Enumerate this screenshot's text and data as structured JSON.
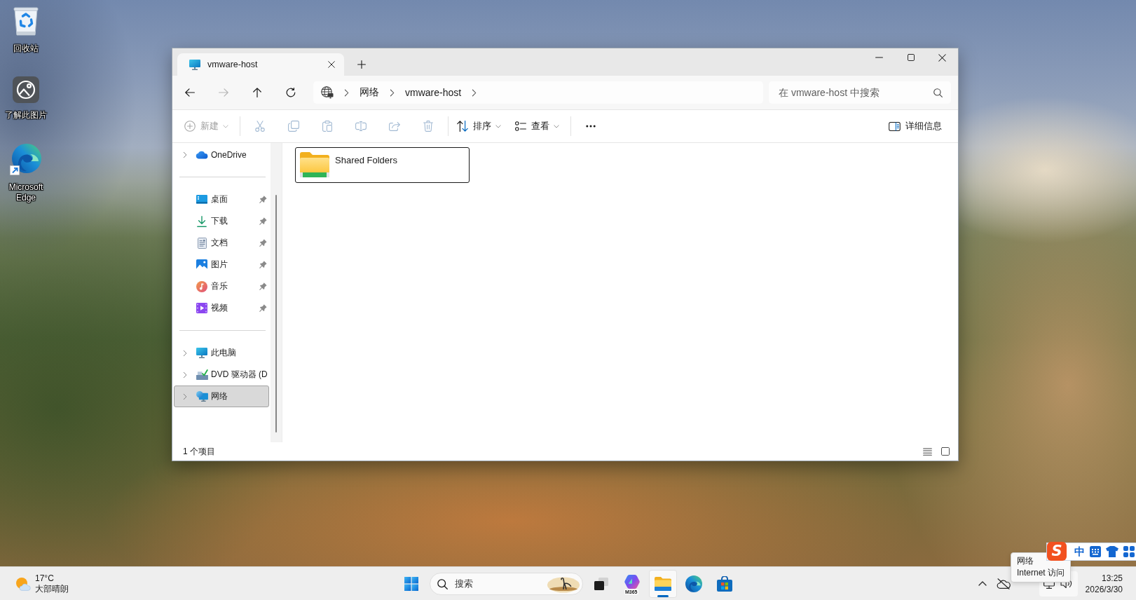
{
  "desktop": {
    "icons": [
      {
        "kind": "recycle-bin",
        "label": "回收站",
        "shortcut": false
      },
      {
        "kind": "picture-info",
        "label": "了解此图片",
        "shortcut": false
      },
      {
        "kind": "browser",
        "label": "Microsoft Edge",
        "shortcut": true
      }
    ]
  },
  "window": {
    "tabs": [
      {
        "title": "vmware-host",
        "selected": true
      }
    ],
    "navigation": [
      {
        "kind": "back",
        "disabled": false
      },
      {
        "kind": "forward",
        "disabled": true
      },
      {
        "kind": "up",
        "disabled": false
      },
      {
        "kind": "refresh",
        "disabled": false
      }
    ],
    "address": {
      "path": [
        "网络",
        "vmware-host"
      ]
    },
    "search": {
      "placeholder": "在 vmware-host 中搜索"
    },
    "toolbar": [
      {
        "kind": "new",
        "label": "新建",
        "disabled": true,
        "dropdown": true
      },
      {
        "kind": "separator"
      },
      {
        "kind": "cut",
        "disabled": true
      },
      {
        "kind": "copy",
        "disabled": true
      },
      {
        "kind": "paste",
        "disabled": true
      },
      {
        "kind": "rename",
        "disabled": true
      },
      {
        "kind": "share",
        "disabled": true
      },
      {
        "kind": "delete",
        "disabled": true
      },
      {
        "kind": "separator"
      },
      {
        "kind": "sort",
        "label": "排序",
        "disabled": false,
        "dropdown": true
      },
      {
        "kind": "view",
        "label": "查看",
        "disabled": false,
        "dropdown": true
      },
      {
        "kind": "separator"
      },
      {
        "kind": "more",
        "disabled": false
      }
    ],
    "details_button": {
      "label": "详细信息"
    },
    "sidebar": {
      "sections": [
        {
          "items": [
            {
              "kind": "onedrive",
              "label": "OneDrive",
              "expandable": true,
              "pinned": false,
              "selected": false
            }
          ]
        },
        {
          "items": [
            {
              "kind": "desktop",
              "label": "桌面",
              "expandable": false,
              "pinned": true,
              "selected": false
            },
            {
              "kind": "downloads",
              "label": "下载",
              "expandable": false,
              "pinned": true,
              "selected": false
            },
            {
              "kind": "documents",
              "label": "文档",
              "expandable": false,
              "pinned": true,
              "selected": false
            },
            {
              "kind": "pictures",
              "label": "图片",
              "expandable": false,
              "pinned": true,
              "selected": false
            },
            {
              "kind": "music",
              "label": "音乐",
              "expandable": false,
              "pinned": true,
              "selected": false
            },
            {
              "kind": "videos",
              "label": "视频",
              "expandable": false,
              "pinned": true,
              "selected": false
            }
          ]
        },
        {
          "items": [
            {
              "kind": "this-pc",
              "label": "此电脑",
              "expandable": true,
              "pinned": false,
              "selected": false
            },
            {
              "kind": "dvd",
              "label": "DVD 驱动器 (D",
              "expandable": true,
              "pinned": false,
              "selected": false
            },
            {
              "kind": "network",
              "label": "网络",
              "expandable": true,
              "pinned": false,
              "selected": true
            }
          ]
        }
      ]
    },
    "items": [
      {
        "kind": "shared-folder",
        "name": "Shared Folders",
        "focused": true
      }
    ],
    "status_bar": {
      "count": "1 个项目",
      "views": [
        {
          "kind": "details"
        },
        {
          "kind": "tiles"
        }
      ]
    }
  },
  "taskbar": {
    "weather": {
      "kind": "partly-sunny",
      "temperature": "17°C",
      "condition": "大部晴朗"
    },
    "search": {
      "placeholder": "搜索"
    },
    "apps": [
      {
        "kind": "task-view",
        "active": false
      },
      {
        "kind": "m365",
        "label": "M365",
        "active": false
      },
      {
        "kind": "file-explorer",
        "active": true
      },
      {
        "kind": "browser",
        "active": false
      },
      {
        "kind": "store",
        "active": false
      }
    ],
    "tray": {
      "icons": [
        {
          "kind": "chevron-up"
        },
        {
          "kind": "cloud-off"
        }
      ],
      "quick_settings": [
        {
          "kind": "network"
        },
        {
          "kind": "volume"
        }
      ]
    },
    "clock": {
      "time": "13:25",
      "date": "2026/3/30"
    }
  },
  "tooltip": {
    "lines": [
      "网络",
      "Internet 访问"
    ]
  },
  "ime_bar": {
    "logo": "S",
    "mode": "中",
    "tools": [
      {
        "kind": "keyboard"
      },
      {
        "kind": "shirt"
      },
      {
        "kind": "grid"
      }
    ]
  }
}
